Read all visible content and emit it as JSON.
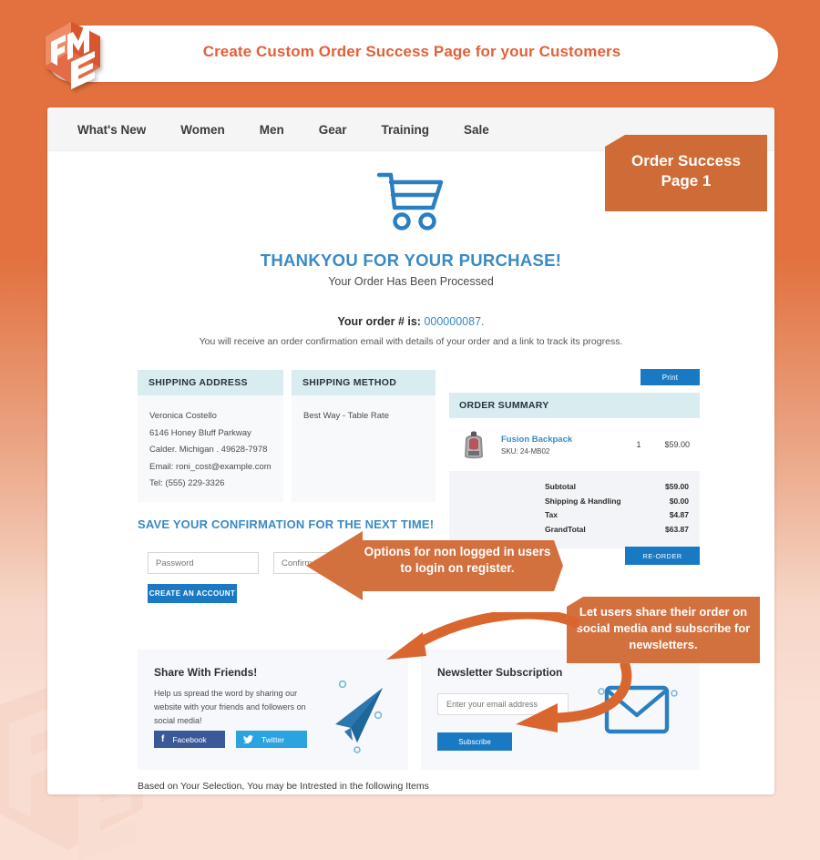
{
  "header": {
    "title": "Create Custom Order Success Page for your Customers",
    "logo_alt": "fme-logo"
  },
  "badge": {
    "label": "Order Success\nPage 1",
    "line1": "Order Success",
    "line2": "Page 1"
  },
  "nav": {
    "items": [
      {
        "label": "What's New"
      },
      {
        "label": "Women"
      },
      {
        "label": "Men"
      },
      {
        "label": "Gear"
      },
      {
        "label": "Training"
      },
      {
        "label": "Sale"
      }
    ]
  },
  "thankyou": {
    "heading": "THANKYOU FOR YOUR PURCHASE!",
    "subheading": "Your Order Has Been Processed",
    "order_label": "Your order # is:",
    "order_number": "000000087.",
    "note": "You will receive an order confirmation email with details of your order and a link to track its progress."
  },
  "shipping_address": {
    "title": "SHIPPING ADDRESS",
    "lines": [
      "Veronica Costello",
      "6146 Honey Bluff Parkway",
      "Calder. Michigan . 49628-7978",
      "Email: roni_cost@example.com",
      "Tel: (555) 229-3326"
    ]
  },
  "shipping_method": {
    "title": "SHIPPING METHOD",
    "value": "Best Way - Table Rate"
  },
  "order_summary": {
    "print_label": "Print",
    "title": "ORDER SUMMARY",
    "item": {
      "name": "Fusion Backpack",
      "sku": "SKU: 24-MB02",
      "qty": "1",
      "price": "$59.00",
      "thumb_alt": "backpack-thumbnail"
    },
    "totals": [
      {
        "label": "Subtotal",
        "value": "$59.00"
      },
      {
        "label": "Shipping & Handling",
        "value": "$0.00"
      },
      {
        "label": "Tax",
        "value": "$4.87"
      },
      {
        "label": "GrandTotal",
        "value": "$63.87"
      }
    ],
    "reorder_label": "RE-ORDER"
  },
  "save_confirmation": {
    "heading": "SAVE YOUR CONFIRMATION FOR THE NEXT TIME!",
    "password_placeholder": "Password",
    "password_value": "",
    "confirm_placeholder": "Confirm Password",
    "confirm_value": "",
    "create_account_label": "CREATE AN ACCOUNT"
  },
  "share": {
    "title": "Share With Friends!",
    "description": "Help us spread the word by sharing our website with your friends and followers on social media!",
    "facebook_label": "Facebook",
    "facebook_glyph": "f",
    "twitter_label": "Twitter",
    "twitter_glyph": "t",
    "plane_icon": "paper-plane-icon"
  },
  "newsletter": {
    "title": "Newsletter Subscription",
    "email_placeholder": "Enter your email address",
    "email_value": "",
    "subscribe_label": "Subscribe",
    "envelope_icon": "envelope-icon"
  },
  "footer": {
    "text": "Based on Your Selection, You may be Intrested in the following Items"
  },
  "callouts": {
    "login": "Options for non logged in users to login on register.",
    "social": "Let users share their order on social media and subscribe for newsletters."
  },
  "colors": {
    "brand_orange": "#e2713f",
    "callout_orange": "#d3713e",
    "badge_orange": "#cf6b36",
    "accent_blue": "#1979c3",
    "heading_blue": "#3a8ac4",
    "panel_header": "#d9edf0",
    "facebook_blue": "#3b5998",
    "twitter_blue": "#2ba3e0"
  }
}
